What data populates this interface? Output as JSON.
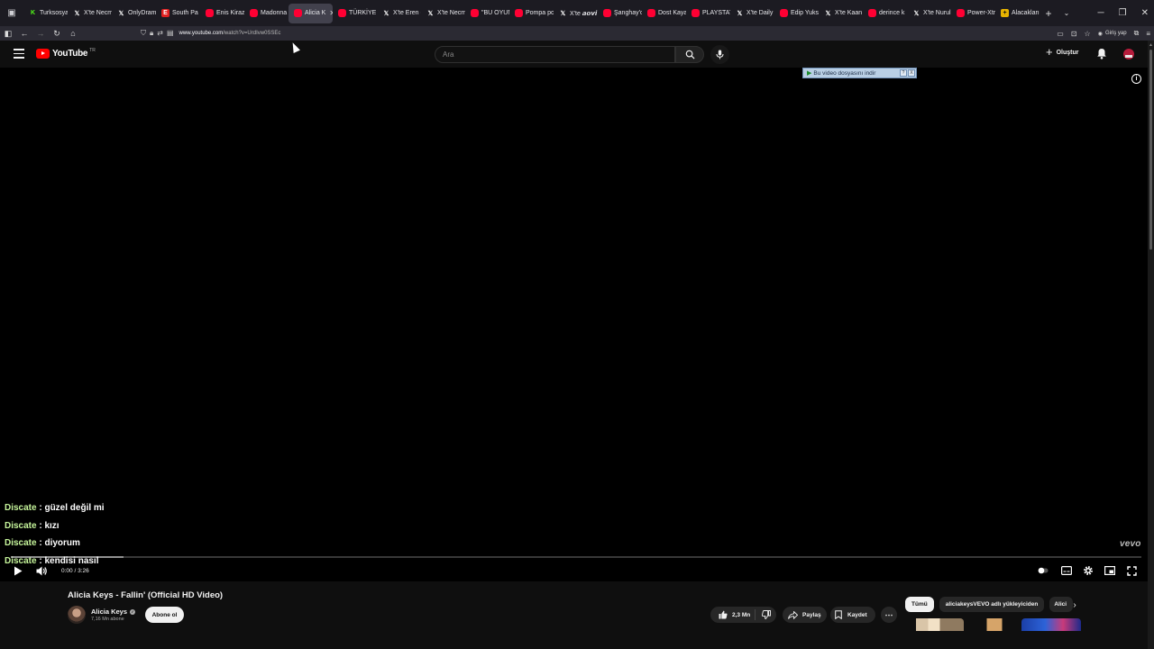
{
  "browser": {
    "tabs": [
      {
        "label": "Turksosyal",
        "favicon": "k"
      },
      {
        "label": "X'te Necm",
        "favicon": "x"
      },
      {
        "label": "OnlyDram",
        "favicon": "x"
      },
      {
        "label": "South Pa",
        "favicon": "e"
      },
      {
        "label": "Enis Kiraz",
        "favicon": "yt"
      },
      {
        "label": "Madonna",
        "favicon": "yt"
      },
      {
        "label": "Alicia K",
        "favicon": "yt",
        "active": true
      },
      {
        "label": "TÜRKİYE N",
        "favicon": "yt"
      },
      {
        "label": "X'te Eren (",
        "favicon": "x"
      },
      {
        "label": "X'te Necm",
        "favicon": "x"
      },
      {
        "label": "\"BU OYUN",
        "favicon": "yt"
      },
      {
        "label": "Pompa po",
        "favicon": "yt"
      },
      {
        "label": "X'te 𝙖𝙤𝙫𝙞",
        "favicon": "x"
      },
      {
        "label": "Şanghay'd",
        "favicon": "yt"
      },
      {
        "label": "Dost Kaya",
        "favicon": "yt"
      },
      {
        "label": "PLAYSTATI",
        "favicon": "yt"
      },
      {
        "label": "X'te Daily",
        "favicon": "x"
      },
      {
        "label": "Edip Yuks",
        "favicon": "yt"
      },
      {
        "label": "X'te Kaan",
        "favicon": "x"
      },
      {
        "label": "derince k",
        "favicon": "yt"
      },
      {
        "label": "X'te Nurul",
        "favicon": "x"
      },
      {
        "label": "Power-Xtr",
        "favicon": "yt"
      },
      {
        "label": "Alacakları",
        "favicon": "gold"
      }
    ],
    "url_domain": "www.youtube.com",
    "url_path": "/watch?v=UrdIvw0SSEc",
    "login_label": "Giriş yap"
  },
  "masthead": {
    "logo_text": "YouTube",
    "logo_country": "TR",
    "search_placeholder": "Ara",
    "create_label": "Oluştur"
  },
  "player": {
    "download_banner": "Bu video dosyasını indir",
    "download_banner_help": "?",
    "download_banner_close": "X",
    "chat": [
      {
        "user": "Discate",
        "message": "güzel değil mi"
      },
      {
        "user": "Discate",
        "message": "kızı"
      },
      {
        "user": "Discate",
        "message": "diyorum"
      },
      {
        "user": "Discate",
        "message": "kendisi nasıl"
      }
    ],
    "watermark": "vevo",
    "time_current": "0:00",
    "time_total": "3:26",
    "buffered_fraction": 0.1
  },
  "video": {
    "title": "Alicia Keys - Fallin' (Official HD Video)",
    "channel": "Alicia Keys",
    "subscribers": "7,16 Mn abone",
    "subscribe_label": "Abone ol",
    "likes": "2,3 Mn",
    "share_label": "Paylaş",
    "save_label": "Kaydet"
  },
  "chips": [
    "Tümü",
    "aliciakeysVEVO adlı yükleyiciden",
    "Alici"
  ],
  "colors": {
    "youtube_red": "#ff0000",
    "chat_username": "#c6f59b",
    "background": "#0f0f0f"
  }
}
